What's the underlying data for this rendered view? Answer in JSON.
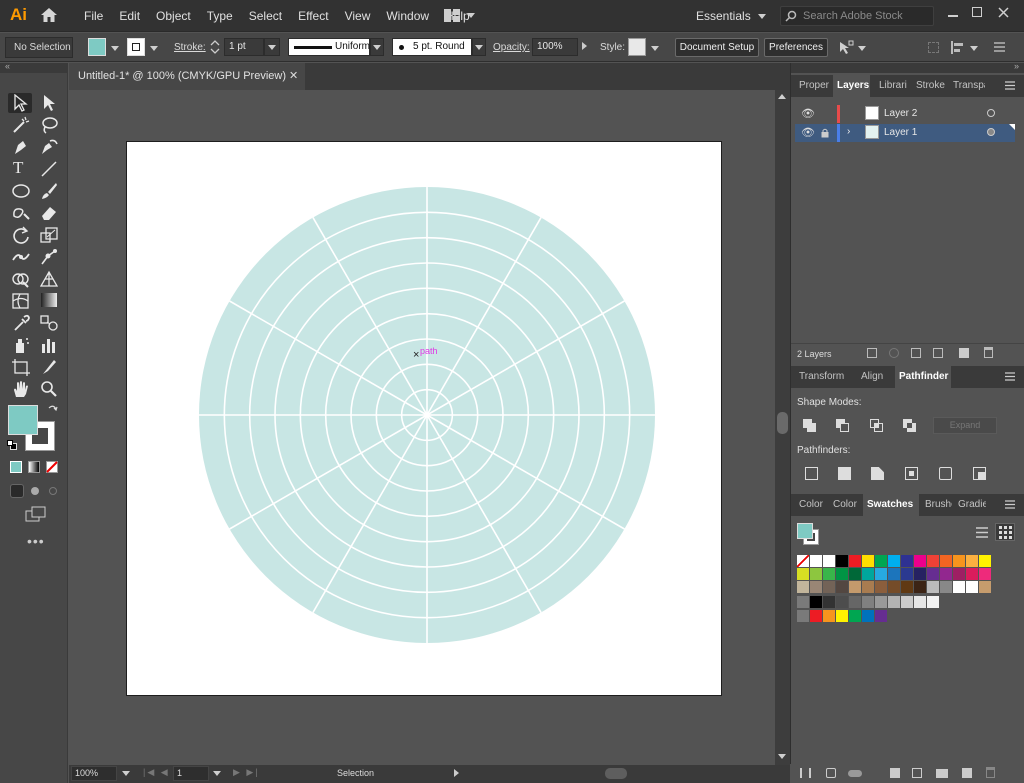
{
  "app": {
    "logo": "Ai"
  },
  "menu": [
    "File",
    "Edit",
    "Object",
    "Type",
    "Select",
    "Effect",
    "View",
    "Window",
    "Help"
  ],
  "workspace": "Essentials",
  "search": {
    "placeholder": "Search Adobe Stock"
  },
  "control": {
    "selection": "No Selection",
    "fill_color": "#7ecac3",
    "stroke_label": "Stroke:",
    "stroke_weight": "1 pt",
    "profile": "Uniform",
    "brush": "5 pt. Round",
    "opacity_label": "Opacity:",
    "opacity": "100%",
    "style_label": "Style:",
    "doc_setup": "Document Setup",
    "preferences": "Preferences"
  },
  "document": {
    "tab": "Untitled-1* @ 100% (CMYK/GPU Preview)",
    "hint": "path"
  },
  "polar": {
    "fill": "#c8e6e4",
    "rings": 9,
    "sectors": 12
  },
  "status": {
    "zoom": "100%",
    "artboard": "1",
    "tool": "Selection"
  },
  "layers_panel": {
    "tabs": [
      "Proper",
      "Layers",
      "Librari",
      "Stroke",
      "Transpa"
    ],
    "layers": [
      {
        "name": "Layer 2",
        "color": "#e84b4b"
      },
      {
        "name": "Layer 1",
        "color": "#4a7ee8"
      }
    ],
    "count": "2 Layers"
  },
  "pathfinder_panel": {
    "tabs": [
      "Transform",
      "Align",
      "Pathfinder"
    ],
    "shape_modes": "Shape Modes:",
    "expand": "Expand",
    "pathfinders": "Pathfinders:"
  },
  "swatches_panel": {
    "tabs": [
      "Color",
      "Color",
      "Swatches",
      "Brushe",
      "Gradie"
    ],
    "rows": [
      [
        "#ffffff",
        "#ffffff",
        "#ffffff",
        "#000000",
        "#ed1c24",
        "#ffde00",
        "#00a651",
        "#00aeef",
        "#2e3192",
        "#ec008c",
        "#ef4136",
        "#f26522",
        "#f7941d",
        "#fbb040",
        "#fff200"
      ],
      [
        "#d7df23",
        "#8dc63f",
        "#39b54a",
        "#009444",
        "#006838",
        "#00a79d",
        "#27aae1",
        "#1c75bc",
        "#2b3990",
        "#262262",
        "#662d91",
        "#92278f",
        "#9e1f63",
        "#da1c5c",
        "#ee2a7b"
      ],
      [
        "#c2b59b",
        "#998675",
        "#736357",
        "#534741",
        "#c49a6c",
        "#a97c50",
        "#8b5e3c",
        "#754c29",
        "#603913",
        "#3c2415",
        "#bbbbbb",
        "#888888",
        "#ffffff",
        "#ffffff",
        "#c69c6d"
      ],
      [
        "#ffffff",
        "#000000",
        "#333333",
        "#4d4d4d",
        "#666666",
        "#808080",
        "#999999",
        "#b3b3b3",
        "#cccccc",
        "#e6e6e6",
        "#f2f2f2"
      ],
      [
        "#ffffff",
        "#ed1c24",
        "#f7941d",
        "#fff200",
        "#00a651",
        "#0072bc",
        "#662d91"
      ]
    ]
  }
}
